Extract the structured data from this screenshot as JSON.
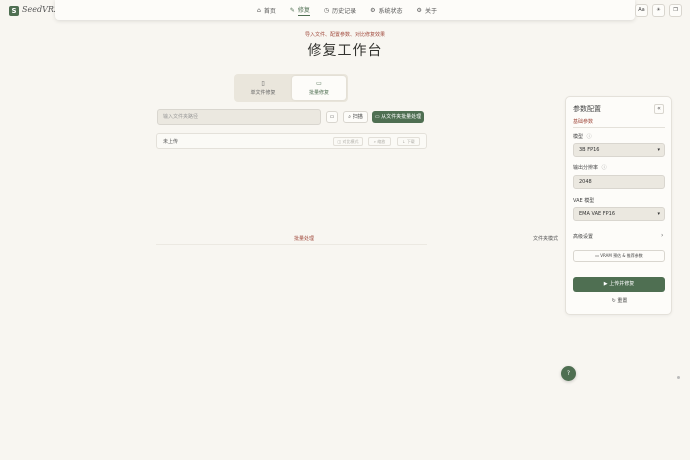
{
  "app": {
    "logo_letter": "S",
    "name": "SeedVR2"
  },
  "nav": {
    "items": [
      {
        "icon": "⌂",
        "label": "首页"
      },
      {
        "icon": "✎",
        "label": "修复"
      },
      {
        "icon": "◷",
        "label": "历史记录"
      },
      {
        "icon": "⚙",
        "label": "系统状态"
      },
      {
        "icon": "⚙",
        "label": "关于"
      }
    ],
    "active_index": 1
  },
  "toolbar": {
    "font_btn": "Aa",
    "theme_btn": "☀",
    "window_btn": "❐"
  },
  "hero": {
    "subtitle": "导入文件、配置参数、对比修复效果",
    "title": "修复工作台"
  },
  "mode_tabs": [
    {
      "icon": "▯",
      "label": "单文件修复"
    },
    {
      "icon": "▭",
      "label": "批量修复"
    }
  ],
  "path": {
    "placeholder": "输入文件夹路径",
    "folder_icon": "▭",
    "scan_label": "扫描",
    "scan_icon": "⌕",
    "batch_label": "从文件夹批量处理",
    "batch_icon": "▭"
  },
  "status": {
    "text": "未上传",
    "compare_label": "对比模式",
    "compare_icon": "◫",
    "zoom_label": "缩放",
    "zoom_icon": "⌕",
    "download_label": "下载",
    "download_icon": "↓"
  },
  "batch": {
    "label": "批量处理",
    "folder_mode": "文件夹模式"
  },
  "panel": {
    "title": "参数配置",
    "collapse_icon": "«",
    "section": "基础参数",
    "model_label": "模型",
    "model_value": "3B FP16",
    "resolution_label": "输出分辨率",
    "resolution_value": "2048",
    "vae_label": "VAE 模型",
    "vae_value": "EMA VAE FP16",
    "advanced_label": "高级设置",
    "advanced_chevron": "›",
    "vram_label": "VRAM 预估 & 推荐参数",
    "vram_icon": "▭",
    "upload_label": "上传并修复",
    "upload_icon": "▶",
    "reset_label": "重置",
    "reset_icon": "↻",
    "info_icon": "ⓘ",
    "caret": "▾"
  },
  "fab": {
    "label": "?"
  },
  "colors": {
    "accent": "#4f6f52",
    "highlight": "#a0493c",
    "background": "#f8f6f1"
  }
}
